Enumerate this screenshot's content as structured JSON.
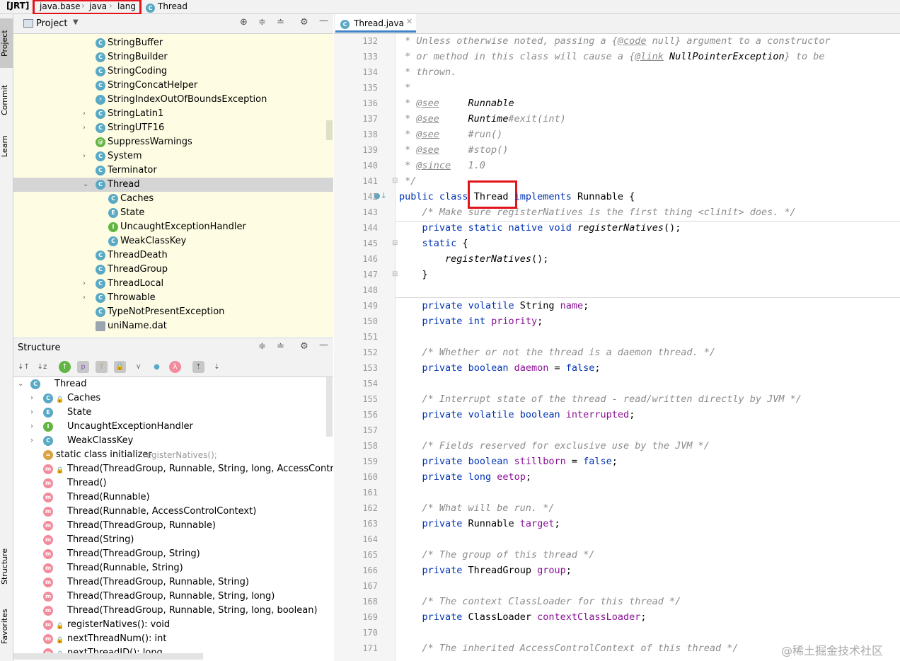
{
  "breadcrumb": {
    "root": "[JRT]",
    "items": [
      "java.base",
      "java",
      "lang",
      "Thread"
    ]
  },
  "left_strip": [
    "Project",
    "Commit",
    "Learn",
    "Structure",
    "Favorites"
  ],
  "project_panel": {
    "title": "Project",
    "tree": [
      {
        "label": "StringBuffer",
        "icon": "class-icon",
        "indent": 1
      },
      {
        "label": "StringBuilder",
        "icon": "class-icon",
        "indent": 1
      },
      {
        "label": "StringCoding",
        "icon": "class-icon",
        "indent": 1
      },
      {
        "label": "StringConcatHelper",
        "icon": "class-icon",
        "indent": 1
      },
      {
        "label": "StringIndexOutOfBoundsException",
        "icon": "exception-class-icon",
        "indent": 1
      },
      {
        "label": "StringLatin1",
        "icon": "class-icon",
        "indent": 1,
        "expandable": true
      },
      {
        "label": "StringUTF16",
        "icon": "class-icon",
        "indent": 1,
        "expandable": true
      },
      {
        "label": "SuppressWarnings",
        "icon": "annotation-icon",
        "indent": 1
      },
      {
        "label": "System",
        "icon": "class-icon",
        "indent": 1,
        "expandable": true
      },
      {
        "label": "Terminator",
        "icon": "class-icon",
        "indent": 1
      },
      {
        "label": "Thread",
        "icon": "class-icon",
        "indent": 1,
        "expanded": true,
        "selected": true
      },
      {
        "label": "Caches",
        "icon": "class-icon",
        "indent": 2
      },
      {
        "label": "State",
        "icon": "enum-icon",
        "indent": 2
      },
      {
        "label": "UncaughtExceptionHandler",
        "icon": "interface-icon",
        "indent": 2
      },
      {
        "label": "WeakClassKey",
        "icon": "class-icon",
        "indent": 2
      },
      {
        "label": "ThreadDeath",
        "icon": "class-icon",
        "indent": 1
      },
      {
        "label": "ThreadGroup",
        "icon": "class-icon",
        "indent": 1
      },
      {
        "label": "ThreadLocal",
        "icon": "class-icon",
        "indent": 1,
        "expandable": true
      },
      {
        "label": "Throwable",
        "icon": "class-icon",
        "indent": 1,
        "expandable": true
      },
      {
        "label": "TypeNotPresentException",
        "icon": "class-icon",
        "indent": 1
      },
      {
        "label": "uniName.dat",
        "icon": "file-icon",
        "indent": 1
      }
    ]
  },
  "structure_panel": {
    "title": "Structure",
    "tree": [
      {
        "label": "Thread",
        "icon": "class-icon",
        "indent": 0,
        "expanded": true
      },
      {
        "label": "Caches",
        "icon": "class-icon",
        "indent": 1,
        "expandable": true
      },
      {
        "label": "State",
        "icon": "enum-icon",
        "indent": 1,
        "expandable": true
      },
      {
        "label": "UncaughtExceptionHandler",
        "icon": "interface-icon",
        "indent": 1,
        "expandable": true
      },
      {
        "label": "WeakClassKey",
        "icon": "class-icon",
        "indent": 1,
        "expandable": true
      },
      {
        "label": "static class initializer",
        "suffix": "registerNatives();",
        "icon": "initializer-icon",
        "indent": 1
      },
      {
        "label": "Thread(ThreadGroup, Runnable, String, long, AccessControlContext, boolean)",
        "icon": "method-icon",
        "indent": 1
      },
      {
        "label": "Thread()",
        "icon": "method-icon",
        "indent": 1
      },
      {
        "label": "Thread(Runnable)",
        "icon": "method-icon",
        "indent": 1
      },
      {
        "label": "Thread(Runnable, AccessControlContext)",
        "icon": "method-icon",
        "indent": 1
      },
      {
        "label": "Thread(ThreadGroup, Runnable)",
        "icon": "method-icon",
        "indent": 1
      },
      {
        "label": "Thread(String)",
        "icon": "method-icon",
        "indent": 1
      },
      {
        "label": "Thread(ThreadGroup, String)",
        "icon": "method-icon",
        "indent": 1
      },
      {
        "label": "Thread(Runnable, String)",
        "icon": "method-icon",
        "indent": 1
      },
      {
        "label": "Thread(ThreadGroup, Runnable, String)",
        "icon": "method-icon",
        "indent": 1
      },
      {
        "label": "Thread(ThreadGroup, Runnable, String, long)",
        "icon": "method-icon",
        "indent": 1
      },
      {
        "label": "Thread(ThreadGroup, Runnable, String, long, boolean)",
        "icon": "method-icon",
        "indent": 1
      },
      {
        "label": "registerNatives(): void",
        "icon": "method-icon",
        "indent": 1
      },
      {
        "label": "nextThreadNum(): int",
        "icon": "method-icon",
        "indent": 1
      },
      {
        "label": "nextThreadID(): long",
        "icon": "method-icon",
        "indent": 1
      }
    ]
  },
  "editor": {
    "tab": "Thread.java",
    "lines": [
      {
        "n": "132",
        "text": " * Unless otherwise noted, passing a {@code null} argument to a constructor"
      },
      {
        "n": "133",
        "text": " * or method in this class will cause a {@link NullPointerException} to be"
      },
      {
        "n": "134",
        "text": " * thrown."
      },
      {
        "n": "135",
        "text": " *"
      },
      {
        "n": "136",
        "text": " * @see     Runnable"
      },
      {
        "n": "137",
        "text": " * @see     Runtime#exit(int)"
      },
      {
        "n": "138",
        "text": " * @see     #run()"
      },
      {
        "n": "139",
        "text": " * @see     #stop()"
      },
      {
        "n": "140",
        "text": " * @since   1.0"
      },
      {
        "n": "141",
        "text": " */"
      },
      {
        "n": "142",
        "text": "public class Thread implements Runnable {"
      },
      {
        "n": "143",
        "text": "    /* Make sure registerNatives is the first thing <clinit> does. */"
      },
      {
        "n": "144",
        "text": "    private static native void registerNatives();"
      },
      {
        "n": "145",
        "text": "    static {"
      },
      {
        "n": "146",
        "text": "        registerNatives();"
      },
      {
        "n": "147",
        "text": "    }"
      },
      {
        "n": "148",
        "text": ""
      },
      {
        "n": "149",
        "text": "    private volatile String name;"
      },
      {
        "n": "150",
        "text": "    private int priority;"
      },
      {
        "n": "151",
        "text": ""
      },
      {
        "n": "152",
        "text": "    /* Whether or not the thread is a daemon thread. */"
      },
      {
        "n": "153",
        "text": "    private boolean daemon = false;"
      },
      {
        "n": "154",
        "text": ""
      },
      {
        "n": "155",
        "text": "    /* Interrupt state of the thread - read/written directly by JVM */"
      },
      {
        "n": "156",
        "text": "    private volatile boolean interrupted;"
      },
      {
        "n": "157",
        "text": ""
      },
      {
        "n": "158",
        "text": "    /* Fields reserved for exclusive use by the JVM */"
      },
      {
        "n": "159",
        "text": "    private boolean stillborn = false;"
      },
      {
        "n": "160",
        "text": "    private long eetop;"
      },
      {
        "n": "161",
        "text": ""
      },
      {
        "n": "162",
        "text": "    /* What will be run. */"
      },
      {
        "n": "163",
        "text": "    private Runnable target;"
      },
      {
        "n": "164",
        "text": ""
      },
      {
        "n": "165",
        "text": "    /* The group of this thread */"
      },
      {
        "n": "166",
        "text": "    private ThreadGroup group;"
      },
      {
        "n": "167",
        "text": ""
      },
      {
        "n": "168",
        "text": "    /* The context ClassLoader for this thread */"
      },
      {
        "n": "169",
        "text": "    private ClassLoader contextClassLoader;"
      },
      {
        "n": "170",
        "text": ""
      },
      {
        "n": "171",
        "text": "    /* The inherited AccessControlContext of this thread */"
      }
    ]
  },
  "watermark": "@稀土掘金技术社区",
  "colors": {
    "highlight_box": "#e2141b",
    "keyword": "#0033b3",
    "field": "#871094",
    "comment": "#8c8c8c"
  }
}
